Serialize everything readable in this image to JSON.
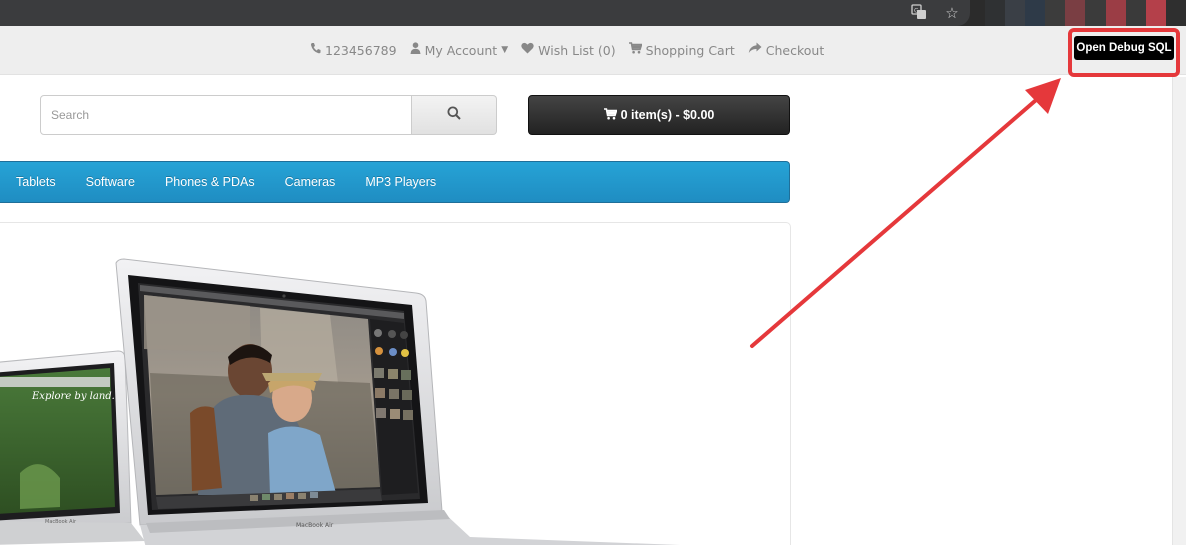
{
  "header": {
    "phone": "123456789",
    "my_account": "My Account",
    "wish_list": "Wish List (0)",
    "shopping_cart": "Shopping Cart",
    "checkout": "Checkout"
  },
  "debug": {
    "button_label": "Open Debug SQL"
  },
  "search": {
    "placeholder": "Search"
  },
  "cart": {
    "label": "0 item(s) - $0.00"
  },
  "menu": {
    "items": [
      {
        "label": "Tablets"
      },
      {
        "label": "Software"
      },
      {
        "label": "Phones & PDAs"
      },
      {
        "label": "Cameras"
      },
      {
        "label": "MP3 Players"
      }
    ]
  },
  "slideshow": {
    "small_screen_text": "Explore by land.",
    "brand_large": "MacBook Air",
    "brand_small": "MacBook Air"
  },
  "colors": {
    "menu_blue": "#229ac8",
    "annotation_red": "#e5383b",
    "cart_dark": "#333333"
  },
  "icons": [
    "translate-icon",
    "star-icon",
    "phone-icon",
    "user-icon",
    "heart-icon",
    "cart-icon",
    "share-icon",
    "search-icon"
  ]
}
